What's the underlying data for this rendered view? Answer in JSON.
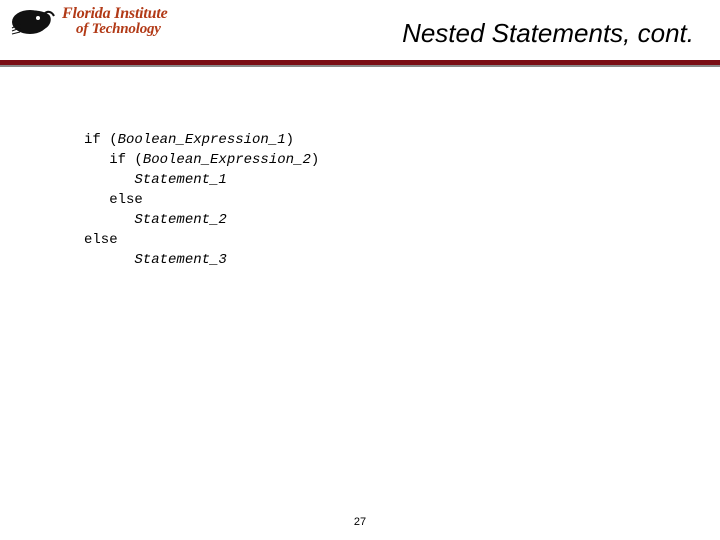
{
  "header": {
    "school_line1": "Florida Institute",
    "school_line2": "of Technology",
    "title": "Nested Statements, cont."
  },
  "code": {
    "l1a": "if (",
    "l1b": "Boolean_Expression_1",
    "l1c": ")",
    "l2a": "   if (",
    "l2b": "Boolean_Expression_2",
    "l2c": ")",
    "l3": "      Statement_1",
    "l4": "   else",
    "l5": "      Statement_2",
    "l6": "else",
    "l7": "      Statement_3"
  },
  "page_number": "27"
}
